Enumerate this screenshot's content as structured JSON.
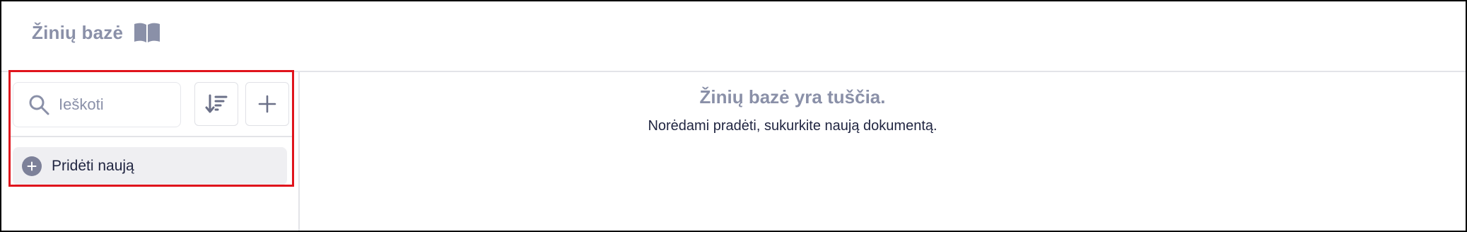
{
  "header": {
    "title": "Žinių bazė",
    "icon": "book-icon"
  },
  "sidebar": {
    "search": {
      "placeholder": "Ieškoti",
      "value": ""
    },
    "sort_button_icon": "sort-descending-icon",
    "add_button_icon": "plus-icon",
    "add_new_label": "Pridėti naują"
  },
  "main": {
    "empty_title": "Žinių bazė yra tuščia.",
    "empty_subtitle": "Norėdami pradėti, sukurkite naują dokumentą."
  },
  "colors": {
    "muted_text": "#8a90a8",
    "dark_text": "#1f2440",
    "highlight": "#e0141c",
    "add_new_bg": "#efeff2",
    "plus_circle": "#7d8199"
  }
}
